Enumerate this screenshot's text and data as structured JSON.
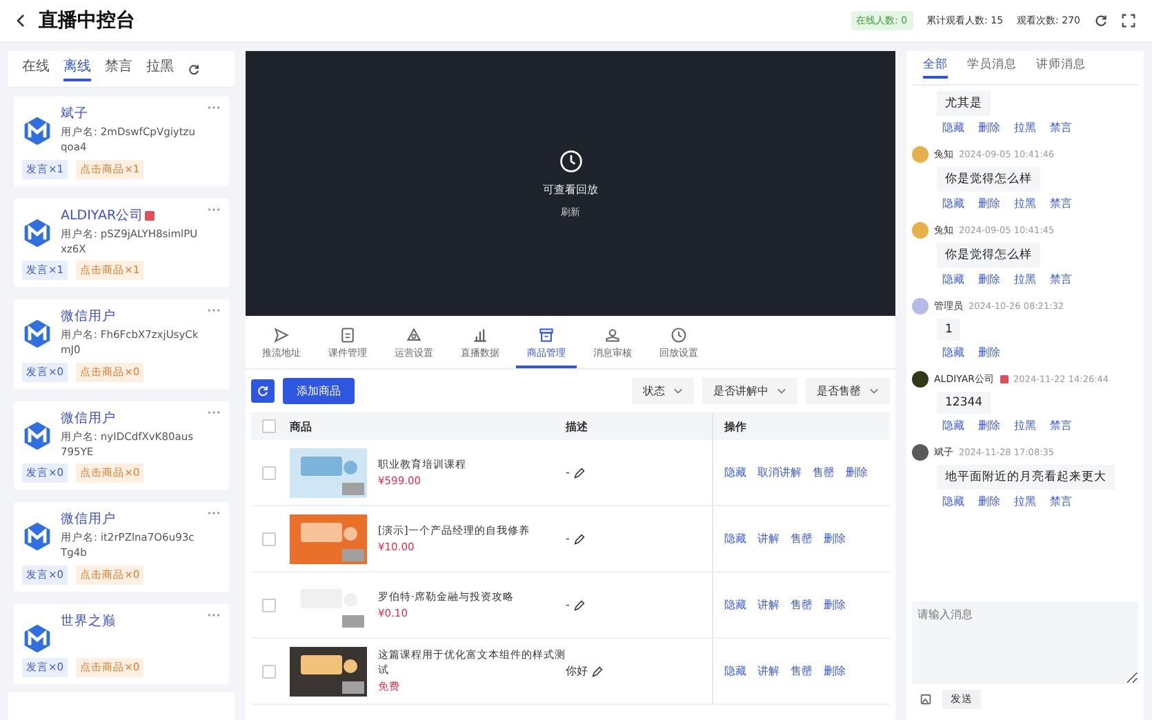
{
  "header": {
    "title": "直播中控台",
    "stats": [
      {
        "kind": "badge",
        "text": "在线人数: 0"
      },
      {
        "kind": "plain",
        "text": "累计观看人数: 15"
      },
      {
        "kind": "plain",
        "text": "观看次数: 270"
      }
    ]
  },
  "user_tabs": [
    {
      "label": "在线",
      "selected": false
    },
    {
      "label": "离线",
      "selected": true
    },
    {
      "label": "禁言",
      "selected": false
    },
    {
      "label": "拉黑",
      "selected": false
    }
  ],
  "users": [
    {
      "name": "斌子",
      "username": "用户名: 2mDswfCpVgiytzuqoa4",
      "flag": false,
      "speak": "发言×1",
      "clicks": "点击商品×1"
    },
    {
      "name": "ALDIYAR公司",
      "username": "用户名: pSZ9jALYH8simlPUxz6X",
      "flag": true,
      "speak": "发言×1",
      "clicks": "点击商品×1"
    },
    {
      "name": "微信用户",
      "username": "用户名: Fh6FcbX7zxjUsyCkmJ0",
      "flag": false,
      "speak": "发言×0",
      "clicks": "点击商品×0"
    },
    {
      "name": "微信用户",
      "username": "用户名: nyIDCdfXvK80aus795YE",
      "flag": false,
      "speak": "发言×0",
      "clicks": "点击商品×0"
    },
    {
      "name": "微信用户",
      "username": "用户名: it2rPZlna7O6u93cTg4b",
      "flag": false,
      "speak": "发言×0",
      "clicks": "点击商品×0"
    },
    {
      "name": "世界之巅",
      "flag": false,
      "speak": "发言×0",
      "clicks": "点击商品×0"
    }
  ],
  "player": {
    "message": "可查看回放",
    "refresh": "刷新"
  },
  "tools": [
    {
      "label": "推流地址",
      "selected": false
    },
    {
      "label": "课件管理",
      "selected": false
    },
    {
      "label": "运营设置",
      "selected": false
    },
    {
      "label": "直播数据",
      "selected": false
    },
    {
      "label": "商品管理",
      "selected": true
    },
    {
      "label": "消息审核",
      "selected": false
    },
    {
      "label": "回放设置",
      "selected": false
    }
  ],
  "toolbar": {
    "add": "添加商品",
    "filters": [
      "状态",
      "是否讲解中",
      "是否售罄"
    ]
  },
  "table": {
    "all_checked": false,
    "columns": [
      "商品",
      "描述",
      "操作"
    ],
    "rows": [
      {
        "checked": false,
        "name": "职业教育培训课程",
        "price": "¥599.00",
        "desc": "-",
        "actions": [
          "隐藏",
          "取消讲解",
          "售罄",
          "删除"
        ]
      },
      {
        "checked": false,
        "name": "[演示]一个产品经理的自我修养",
        "price": "¥10.00",
        "desc": "-",
        "actions": [
          "隐藏",
          "讲解",
          "售罄",
          "删除"
        ]
      },
      {
        "checked": false,
        "name": "罗伯特·席勒金融与投资攻略",
        "price": "¥0.10",
        "desc": "-",
        "actions": [
          "隐藏",
          "讲解",
          "售罄",
          "删除"
        ]
      },
      {
        "checked": false,
        "name": "这篇课程用于优化富文本组件的样式测试",
        "price": "免费",
        "desc": "你好",
        "actions": [
          "隐藏",
          "讲解",
          "售罄",
          "删除"
        ]
      }
    ]
  },
  "chat_tabs": [
    {
      "label": "全部",
      "selected": true
    },
    {
      "label": "学员消息",
      "selected": false
    },
    {
      "label": "讲师消息",
      "selected": false
    }
  ],
  "messages": [
    {
      "text": "尤其是",
      "actions": [
        "隐藏",
        "删除",
        "拉黑",
        "禁言"
      ]
    },
    {
      "name": "兔知",
      "time": "2024-09-05 10:41:46",
      "text": "你是觉得怎么样",
      "actions": [
        "隐藏",
        "删除",
        "拉黑",
        "禁言"
      ]
    },
    {
      "name": "兔知",
      "time": "2024-09-05 10:41:45",
      "text": "你是觉得怎么样",
      "actions": [
        "隐藏",
        "删除",
        "拉黑",
        "禁言"
      ]
    },
    {
      "name": "管理员",
      "time": "2024-10-26 08:21:32",
      "text": "1",
      "actions": [
        "隐藏",
        "删除"
      ]
    },
    {
      "name": "ALDIYAR公司",
      "flag": true,
      "time": "2024-11-22 14:26:44",
      "text": "12344",
      "actions": [
        "隐藏",
        "删除",
        "拉黑",
        "禁言"
      ]
    },
    {
      "name": "斌子",
      "time": "2024-11-28 17:08:35",
      "text": "地平面附近的月亮看起来更大",
      "actions": [
        "隐藏",
        "删除",
        "拉黑",
        "禁言"
      ]
    }
  ],
  "composer": {
    "placeholder": "请输入消息",
    "send": "发送"
  }
}
